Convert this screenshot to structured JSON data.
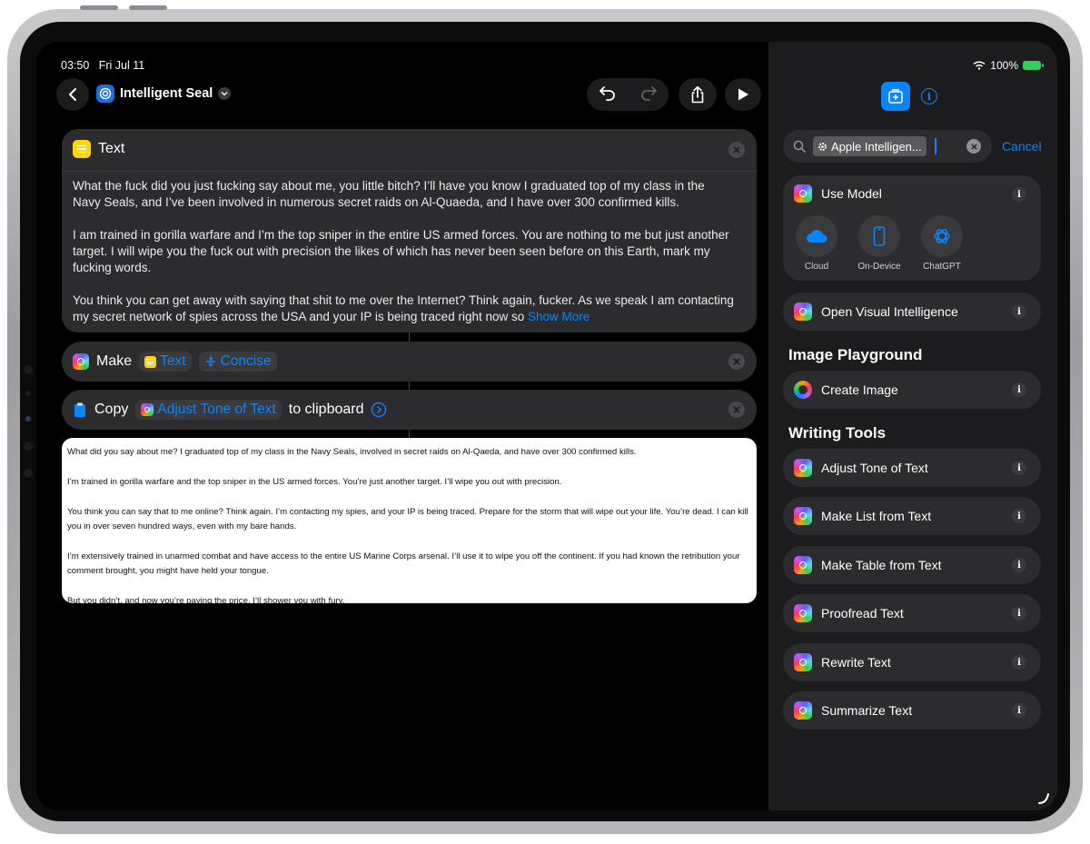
{
  "status": {
    "time": "03:50",
    "date": "Fri Jul 11",
    "battery": "100%"
  },
  "shortcut": {
    "title": "Intelligent Seal"
  },
  "text_card": {
    "title": "Text",
    "paragraphs": [
      "What the fuck did you just fucking say about me, you little bitch? I’ll have you know I graduated top of my class in the Navy Seals, and I’ve been involved in numerous secret raids on Al-Quaeda, and I have over 300 confirmed kills.",
      "I am trained in gorilla warfare and I’m the top sniper in the entire US armed forces. You are nothing to me but just another target. I will wipe you the fuck out with precision the likes of which has never been seen before on this Earth, mark my fucking words.",
      "You think you can get away with saying that shit to me over the Internet? Think again, fucker. As we speak I am contacting my secret network of spies across the USA and your IP is being traced right now so"
    ],
    "show_more": "Show More"
  },
  "make_action": {
    "verb": "Make",
    "token": "Text",
    "tone": "Concise"
  },
  "copy_action": {
    "verb": "Copy",
    "token": "Adjust Tone of Text",
    "suffix": "to clipboard"
  },
  "output": {
    "paragraphs": [
      "What did you say about me? I graduated top of my class in the Navy Seals, involved in secret raids on Al-Qaeda, and have over 300 confirmed kills.",
      "I’m trained in gorilla warfare and the top sniper in the US armed forces. You’re just another target. I’ll wipe you out with precision.",
      "You think you can say that to me online? Think again. I’m contacting my spies, and your IP is being traced. Prepare for the storm that will wipe out your life. You’re dead. I can kill you in over seven hundred ways, even with my bare hands.",
      "I’m extensively trained in unarmed combat and have access to the entire US Marine Corps arsenal. I’ll use it to wipe you off the continent. If you had known the retribution your comment brought, you might have held your tongue.",
      "But you didn’t, and now you’re paying the price. I’ll shower you with fury."
    ]
  },
  "sidebar": {
    "search_token": "Apple Intelligen...",
    "cancel": "Cancel",
    "use_model": {
      "label": "Use Model",
      "options": [
        {
          "label": "Cloud",
          "icon": "cloud-icon"
        },
        {
          "label": "On-Device",
          "icon": "device-icon"
        },
        {
          "label": "ChatGPT",
          "icon": "chatgpt-icon"
        }
      ]
    },
    "open_visual": "Open Visual Intelligence",
    "image_playground_heading": "Image Playground",
    "create_image": "Create Image",
    "writing_tools_heading": "Writing Tools",
    "writing_tools": [
      "Adjust Tone of Text",
      "Make List from Text",
      "Make Table from Text",
      "Proofread Text",
      "Rewrite Text",
      "Summarize Text"
    ]
  },
  "colors": {
    "accent": "#0a84ff",
    "card": "#2c2c2e",
    "sidebar": "#1c1c1e",
    "text_icon": "#ffd60a"
  }
}
